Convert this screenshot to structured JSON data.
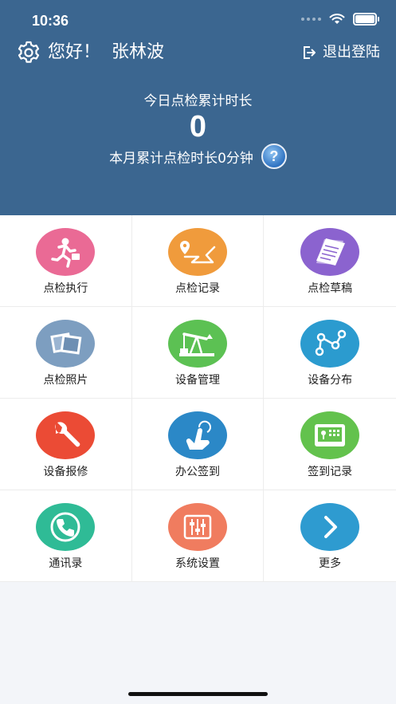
{
  "status_bar": {
    "time": "10:36"
  },
  "header": {
    "greeting": "您好！",
    "user_name": "张林波",
    "logout_label": "退出登陆",
    "today_label": "今日点检累计时长",
    "today_value": "0",
    "month_label": "本月累计点检时长0分钟",
    "help_symbol": "?",
    "background_color": "#3b6690"
  },
  "menu": [
    {
      "label": "点检执行",
      "icon": "running-man-icon",
      "color": "#ea6a95"
    },
    {
      "label": "点检记录",
      "icon": "route-pin-icon",
      "color": "#f09b3c"
    },
    {
      "label": "点检草稿",
      "icon": "stacked-papers-icon",
      "color": "#8b63cf"
    },
    {
      "label": "点检照片",
      "icon": "photos-icon",
      "color": "#7d9ec0"
    },
    {
      "label": "设备管理",
      "icon": "oil-pump-icon",
      "color": "#5cc153"
    },
    {
      "label": "设备分布",
      "icon": "node-network-icon",
      "color": "#2b9bcf"
    },
    {
      "label": "设备报修",
      "icon": "wrench-icon",
      "color": "#eb4b35"
    },
    {
      "label": "办公签到",
      "icon": "touch-hand-icon",
      "color": "#2b88c7"
    },
    {
      "label": "签到记录",
      "icon": "attendance-terminal-icon",
      "color": "#63c24d"
    },
    {
      "label": "通讯录",
      "icon": "phone-icon",
      "color": "#2fbb96"
    },
    {
      "label": "系统设置",
      "icon": "sliders-icon",
      "color": "#f07c5f"
    },
    {
      "label": "更多",
      "icon": "chevron-right-icon",
      "color": "#2e9bd0"
    }
  ]
}
